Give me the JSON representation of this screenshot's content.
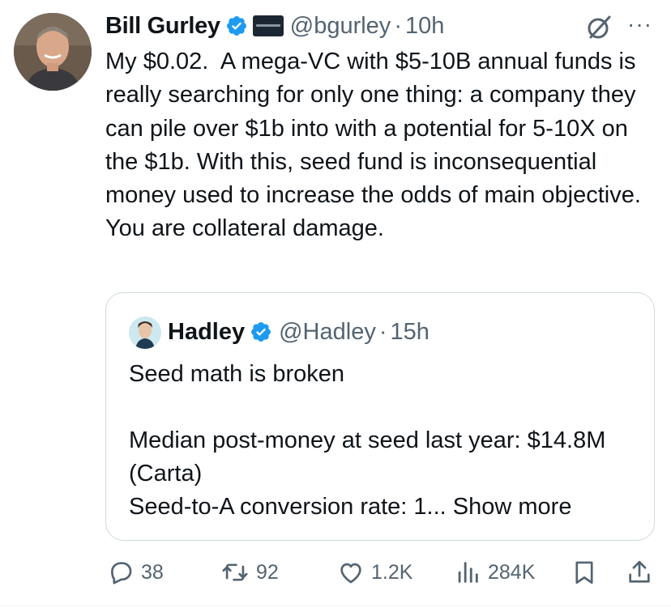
{
  "tweet": {
    "author_name": "Bill Gurley",
    "author_handle": "@bgurley",
    "separator": "·",
    "time": "10h",
    "more_label": "···",
    "text": "My $0.02.  A mega-VC with $5-10B annual funds is really searching for only one thing: a company they can pile over $1b into with a potential for 5-10X on the $1b. With this, seed fund is inconsequential money used to increase the odds of main objective. You are collateral damage."
  },
  "quote": {
    "author_name": "Hadley",
    "author_handle": "@Hadley",
    "separator": "·",
    "time": "15h",
    "text": "Seed math is broken\n\nMedian post-money at seed last year: $14.8M (Carta)\nSeed-to-A conversion rate: 1...",
    "show_more": "Show more"
  },
  "actions": {
    "replies": "38",
    "reposts": "92",
    "likes": "1.2K",
    "views": "284K"
  },
  "icons": {
    "verified": "verified-badge-icon",
    "reply": "reply-icon",
    "repost": "repost-icon",
    "like": "heart-icon",
    "views": "views-chart-icon",
    "bookmark": "bookmark-icon",
    "share": "share-icon",
    "grok": "grok-icon"
  },
  "colors": {
    "verified_blue": "#1d9bf0",
    "secondary_text": "#536471",
    "primary_text": "#0f1419",
    "border": "#cfd9de"
  }
}
